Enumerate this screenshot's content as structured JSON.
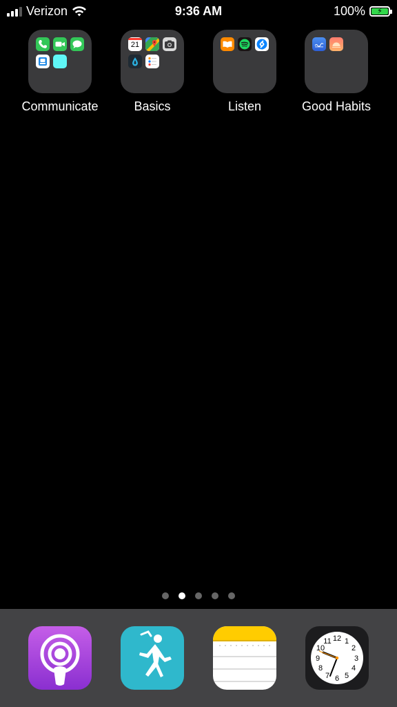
{
  "status_bar": {
    "carrier": "Verizon",
    "time": "9:36 AM",
    "battery_percent": "100%"
  },
  "folders": [
    {
      "label": "Communicate",
      "apps": [
        "phone-icon",
        "facetime-icon",
        "messages-icon",
        "outlook-icon",
        "cyan-app-icon"
      ]
    },
    {
      "label": "Basics",
      "apps": [
        "calendar-icon",
        "maps-icon",
        "camera-icon",
        "water-app-icon",
        "reminders-icon"
      ],
      "calendar_day": "21"
    },
    {
      "label": "Listen",
      "apps": [
        "books-icon",
        "spotify-icon",
        "shazam-icon"
      ]
    },
    {
      "label": "Good Habits",
      "apps": [
        "blue-app-icon",
        "pink-app-icon"
      ]
    }
  ],
  "pages": {
    "count": 5,
    "active_index": 1
  },
  "dock": {
    "apps": [
      "podcasts-icon",
      "runkeeper-icon",
      "notes-icon",
      "clock-icon"
    ]
  },
  "clock": {
    "numbers": [
      "12",
      "1",
      "2",
      "3",
      "4",
      "5",
      "6",
      "7",
      "8",
      "9",
      "10",
      "11"
    ]
  },
  "colors": {
    "folder_bg": "#3a3a3c",
    "dock_bg": "#434345",
    "battery_green": "#32d74b"
  }
}
